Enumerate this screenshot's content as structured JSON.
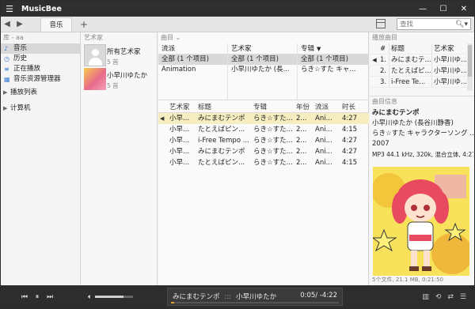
{
  "app": {
    "title": "MusicBee"
  },
  "toolbar": {
    "tab_label": "音乐",
    "add_tab": "+",
    "search_placeholder": "查找"
  },
  "left": {
    "library_header": "库 - aa",
    "items": [
      {
        "label": "音乐",
        "icon": "♪"
      },
      {
        "label": "历史",
        "icon": "◷"
      },
      {
        "label": "正在播放",
        "icon": "≡"
      },
      {
        "label": "音乐资源管理器",
        "icon": "▦"
      }
    ],
    "groups": [
      {
        "label": "播放列表"
      },
      {
        "label": "计算机"
      }
    ]
  },
  "artists": {
    "header": "艺术家",
    "rows": [
      {
        "name": "所有艺术家",
        "count": "5 首"
      },
      {
        "name": "小早川ゆたか",
        "count": "5 首"
      }
    ]
  },
  "songs": {
    "header": "曲目",
    "filters": [
      {
        "head": "流派",
        "items": [
          "全部  (1 个项目)",
          "Animation"
        ]
      },
      {
        "head": "艺术家",
        "items": [
          "全部  (1 个项目)",
          "小早川ゆたか (長..."
        ]
      },
      {
        "head": "专辑",
        "items": [
          "全部  (1 个项目)",
          "らき☆すた キャ..."
        ]
      }
    ],
    "columns": [
      "艺术家",
      "标题",
      "专辑",
      "年份",
      "流派",
      "时长"
    ],
    "tracks": [
      {
        "artist": "小早...",
        "title": "みにまむテンポ",
        "album": "らき☆すた...",
        "year": "2...",
        "genre": "Ani...",
        "time": "4:27",
        "playing": true
      },
      {
        "artist": "小早...",
        "title": "たとえばピン...",
        "album": "らき☆すた...",
        "year": "2...",
        "genre": "Ani...",
        "time": "4:15",
        "playing": false
      },
      {
        "artist": "小早...",
        "title": "i-Free Tempo ...",
        "album": "らき☆すた...",
        "year": "2...",
        "genre": "Ani...",
        "time": "4:27",
        "playing": false
      },
      {
        "artist": "小早...",
        "title": "みにまむテンポ",
        "album": "らき☆すた...",
        "year": "2...",
        "genre": "Ani...",
        "time": "4:27",
        "playing": false
      },
      {
        "artist": "小早...",
        "title": "たとえばピン...",
        "album": "らき☆すた...",
        "year": "2...",
        "genre": "Ani...",
        "time": "4:15",
        "playing": false
      }
    ]
  },
  "now_playing_list": {
    "header": "播放曲目",
    "columns": [
      "#",
      "标题",
      "艺术家"
    ],
    "rows": [
      {
        "num": "1.",
        "title": "みにまむテ...",
        "artist": "小早川ゆ...",
        "playing": true
      },
      {
        "num": "2.",
        "title": "たとえばピ...",
        "artist": "小早川ゆ...",
        "playing": false
      },
      {
        "num": "3.",
        "title": "i-Free Te...",
        "artist": "小早川ゆ...",
        "playing": false
      }
    ]
  },
  "info": {
    "header": "曲目信息",
    "title": "みにまむテンポ",
    "artist": "小早川ゆたか (長谷川静香)",
    "album": "らき☆すた キャラクターソング ...",
    "year": "2007",
    "meta": "MP3 44.1 kHz, 320k, 混合立体, 4:27"
  },
  "status_text": "5个文件, 21.1 MB, 0:21:50",
  "player": {
    "now_title": "みにまむテンポ",
    "separator": ":::",
    "now_artist": "小早川ゆたか",
    "time": "0:05/ -4:22",
    "progress": 0.02,
    "volume": 0.75
  }
}
